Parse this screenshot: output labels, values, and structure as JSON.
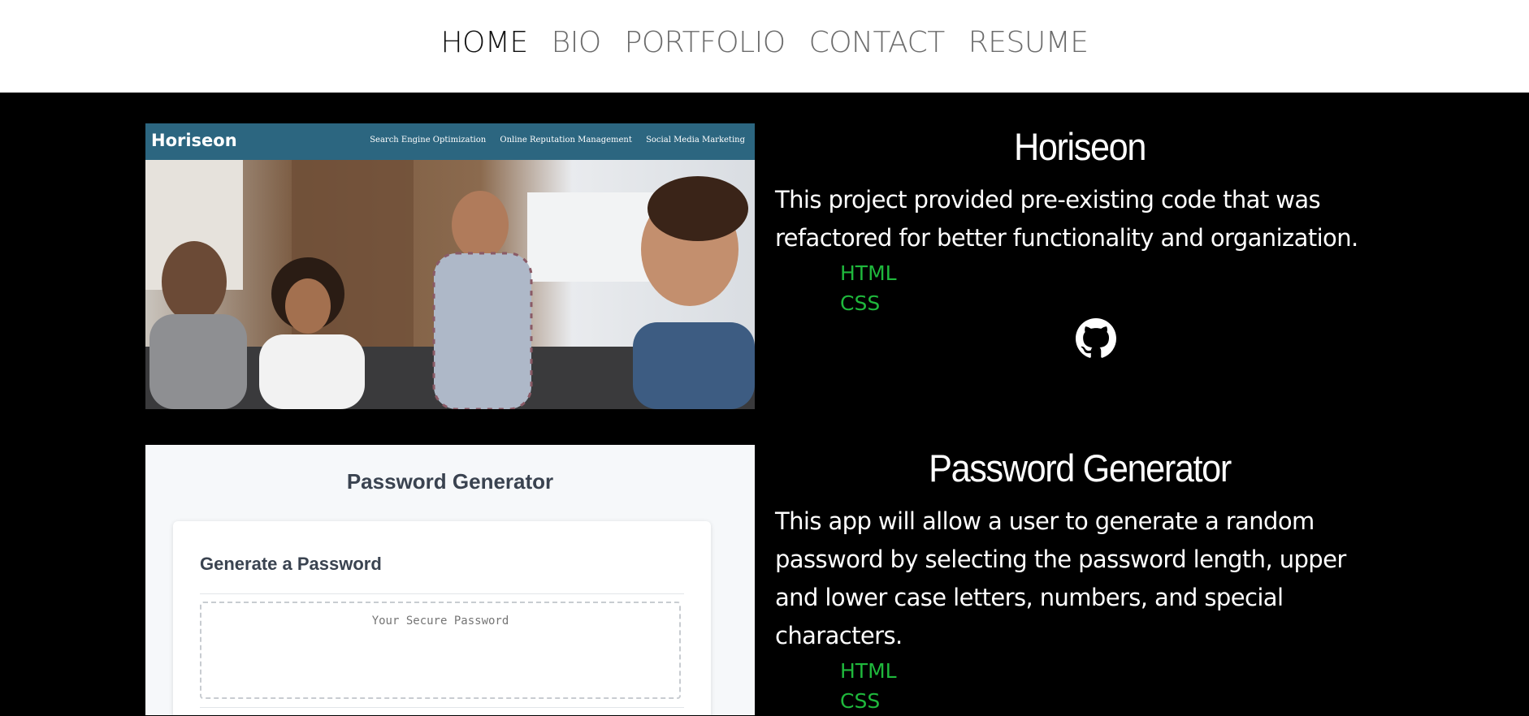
{
  "nav": {
    "links": [
      "HOME",
      "BIO",
      "PORTFOLIO",
      "CONTACT",
      "RESUME"
    ]
  },
  "colors": {
    "accent_green": "#1fb83c",
    "horiseon_bar": "#2c6680"
  },
  "projects": [
    {
      "title": "Horiseon",
      "description": "This project provided pre-existing code that was refactored for better functionality and organization.",
      "tech": [
        "HTML",
        "CSS"
      ],
      "link_icon": "github-icon",
      "screenshot": {
        "logo": "Horiseon",
        "links": [
          "Search Engine Optimization",
          "Online Reputation Management",
          "Social Media Marketing"
        ]
      }
    },
    {
      "title": "Password Generator",
      "description": "This app will allow a user to generate a random password by selecting the password length, upper and lower case letters, numbers, and special characters.",
      "tech": [
        "HTML",
        "CSS"
      ],
      "screenshot": {
        "heading": "Password Generator",
        "card_heading": "Generate a Password",
        "placeholder": "Your Secure Password"
      }
    }
  ]
}
